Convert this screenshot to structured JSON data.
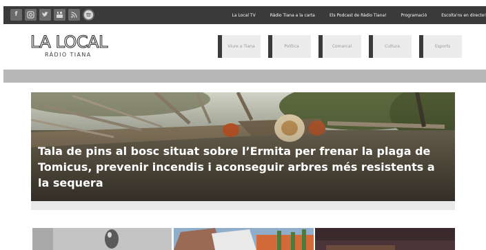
{
  "topbar": {
    "social_icons": [
      {
        "name": "facebook-icon",
        "glyph": "f"
      },
      {
        "name": "instagram-icon",
        "glyph": "◻"
      },
      {
        "name": "twitter-icon",
        "glyph": "❥"
      },
      {
        "name": "youtube-icon",
        "glyph": "▶"
      },
      {
        "name": "rss-icon",
        "glyph": "◝"
      },
      {
        "name": "spotify-icon",
        "glyph": ""
      }
    ],
    "links": [
      "La Local TV",
      "Ràdio Tiana a la carta",
      "Els Podcast de Ràdio Tiana!",
      "Programació",
      "Escolta'ns en directe!"
    ]
  },
  "logo": {
    "main": "LA LOCAL",
    "sub": "RÀDIO TIANA"
  },
  "nav": [
    "Viure a Tiana",
    "Política",
    "Comarcal",
    "Cultura",
    "Esports"
  ],
  "hero": {
    "title": "Tala de pins al bosc situat sobre l’Ermita per frenar la plaga de Tomicus, prevenir incendis i aconseguir arbres més resistents a la sequera"
  },
  "colors": {
    "topbar": "#3a3a3a",
    "accent_gray": "#b8b8b8",
    "nav_bg": "#ececec"
  }
}
